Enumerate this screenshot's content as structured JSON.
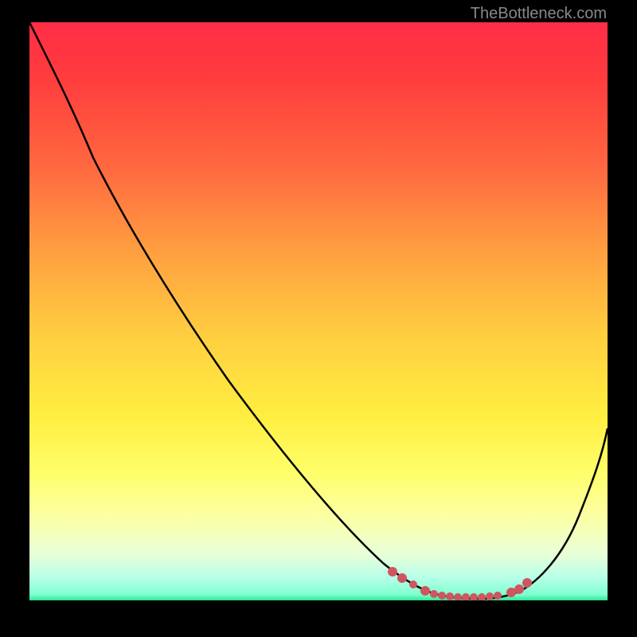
{
  "attribution": "TheBottleneck.com",
  "chart_data": {
    "type": "line",
    "title": "",
    "xlabel": "",
    "ylabel": "",
    "x_range": [
      0,
      100
    ],
    "y_range": [
      0,
      100
    ],
    "series": [
      {
        "name": "bottleneck-curve",
        "x": [
          0,
          10,
          20,
          30,
          40,
          50,
          60,
          68,
          72,
          78,
          80,
          84,
          88,
          100
        ],
        "y": [
          100,
          88,
          76,
          62,
          48,
          34,
          20,
          6,
          2,
          1,
          1,
          2,
          4,
          30
        ]
      }
    ],
    "markers": {
      "name": "optimal-range-markers",
      "x": [
        64,
        65,
        67,
        69,
        71,
        73,
        75,
        77,
        79,
        81,
        83,
        84,
        85,
        86
      ],
      "y": [
        5,
        4.5,
        3,
        2,
        1.5,
        1.2,
        1,
        1,
        1.2,
        1.5,
        2,
        2.5,
        3.5,
        5
      ],
      "color": "#CE5660"
    },
    "gradient_colors": {
      "top": "#FF2D47",
      "bottom": "#2FE58E"
    }
  }
}
